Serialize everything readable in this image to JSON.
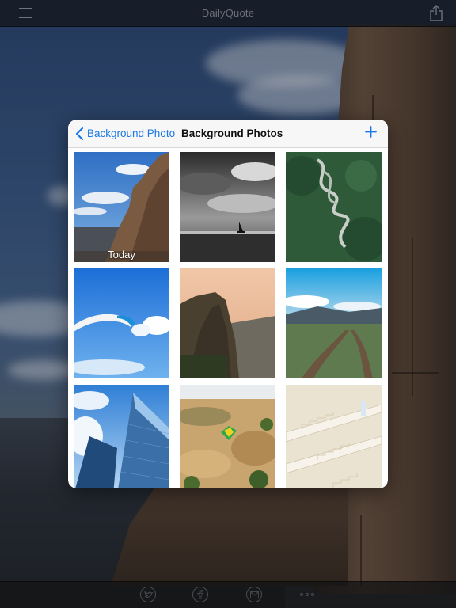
{
  "app": {
    "title": "DailyQuote"
  },
  "topbar": {
    "menu_icon": "hamburger-menu-icon",
    "share_icon": "share-icon"
  },
  "popover": {
    "back_label": "Background Photo",
    "title": "Background Photos",
    "add_icon": "plus-icon",
    "accent_color": "#1a78e6",
    "photos": [
      {
        "subject": "rock-spire-sky",
        "label": "Today"
      },
      {
        "subject": "sailboat-bw-sea",
        "label": ""
      },
      {
        "subject": "aerial-winding-road-forest",
        "label": ""
      },
      {
        "subject": "paraglider-blue-sky",
        "label": ""
      },
      {
        "subject": "cliff-sunset",
        "label": ""
      },
      {
        "subject": "dirt-road-field",
        "label": ""
      },
      {
        "subject": "glass-skyscraper",
        "label": ""
      },
      {
        "subject": "hot-air-balloon-landscape",
        "label": ""
      },
      {
        "subject": "white-staircases",
        "label": ""
      }
    ]
  },
  "bottombar": {
    "icons": [
      "twitter-icon",
      "facebook-icon",
      "mail-icon",
      "more-icon"
    ]
  }
}
